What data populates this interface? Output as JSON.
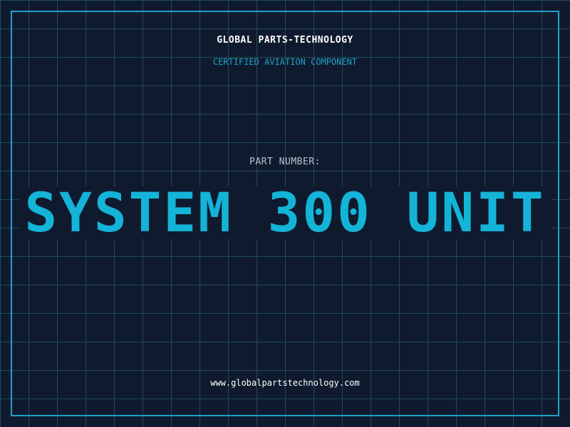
{
  "header": {
    "company": "GLOBAL PARTS-TECHNOLOGY",
    "tagline": "CERTIFIED AVIATION COMPONENT"
  },
  "part": {
    "label": "PART NUMBER:",
    "number": "SYSTEM 300 UNIT"
  },
  "footer": {
    "website": "www.globalpartstechnology.com"
  },
  "colors": {
    "background": "#101a2e",
    "grid": "#1f4a5c",
    "accent": "#14b4d8",
    "label": "#b9c2cc",
    "text": "#ffffff"
  }
}
